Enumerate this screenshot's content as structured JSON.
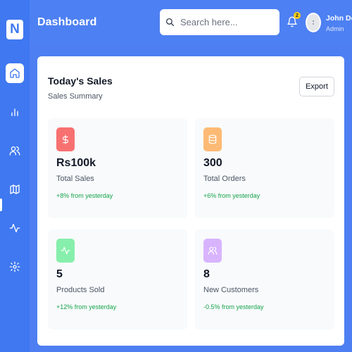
{
  "app": {
    "logo_letter": "N",
    "page_title": "Dashboard"
  },
  "search": {
    "placeholder": "Search here..."
  },
  "notifications": {
    "count": "2"
  },
  "user": {
    "name": "John Doe",
    "role": "Admin"
  },
  "sidebar": {
    "items": [
      {
        "icon": "home-icon",
        "active": true
      },
      {
        "icon": "bar-chart-icon",
        "active": false
      },
      {
        "icon": "users-icon",
        "active": false
      },
      {
        "icon": "map-icon",
        "active": false
      },
      {
        "icon": "activity-icon",
        "active": false
      },
      {
        "icon": "settings-icon",
        "active": false
      }
    ]
  },
  "sales_card": {
    "title": "Today's Sales",
    "subtitle": "Sales Summary",
    "export_label": "Export",
    "stats": [
      {
        "icon": "dollar-icon",
        "icon_bg": "#f87171",
        "value": "Rs100k",
        "label": "Total Sales",
        "change": "+8% from yesterday"
      },
      {
        "icon": "database-icon",
        "icon_bg": "#fdba74",
        "value": "300",
        "label": "Total Orders",
        "change": "+6% from yesterday"
      },
      {
        "icon": "activity-icon",
        "icon_bg": "#86efac",
        "value": "5",
        "label": "Products Sold",
        "change": "+12% from yesterday"
      },
      {
        "icon": "users-icon",
        "icon_bg": "#d8b4fe",
        "value": "8",
        "label": "New Customers",
        "change": "-0.5% from yesterday"
      }
    ]
  },
  "colors": {
    "sidebar_bg": "#3f78f0",
    "topbar_bg": "#4d80f2",
    "positive_change": "#16a34a",
    "badge": "#facc15"
  }
}
